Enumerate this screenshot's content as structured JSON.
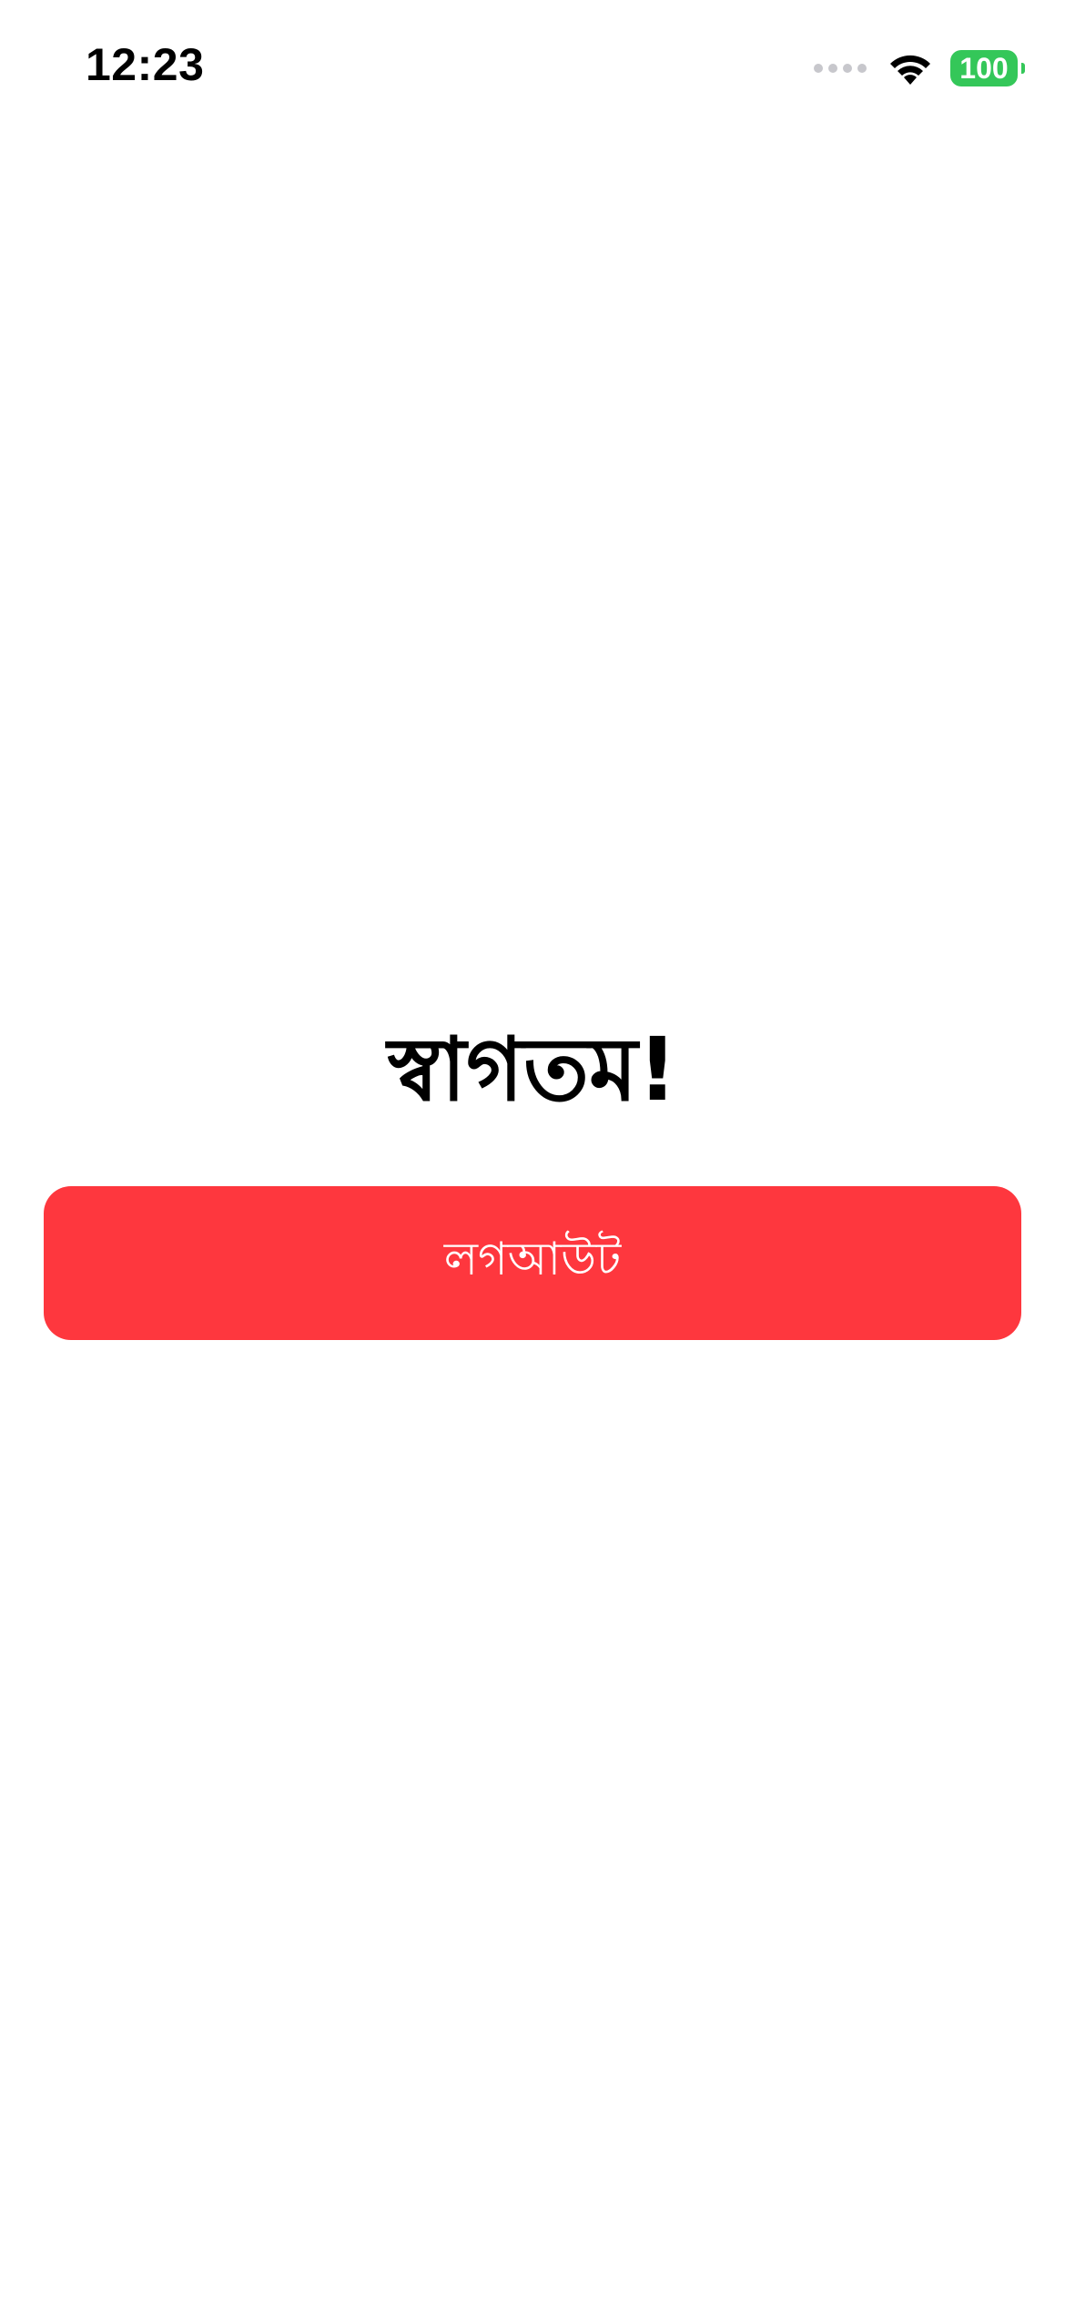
{
  "status_bar": {
    "time": "12:23",
    "battery_level": "100",
    "signal_icon": "signal-dots-icon",
    "wifi_icon": "wifi-icon",
    "battery_color": "#34c759"
  },
  "main": {
    "title": "স্বাগতম!",
    "logout_label": "লগআউট",
    "logout_color": "#fe373e"
  }
}
